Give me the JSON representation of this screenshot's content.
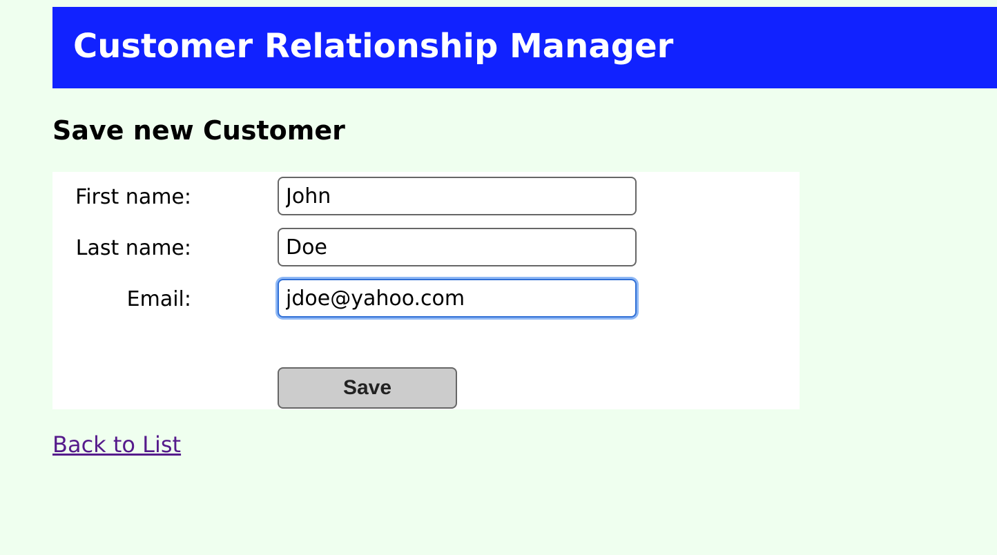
{
  "header": {
    "title": "Customer Relationship Manager",
    "background_color": "#1122ff"
  },
  "page": {
    "title": "Save new Customer",
    "background_color": "#efffef"
  },
  "form": {
    "first_name": {
      "label": "First name:",
      "value": "John"
    },
    "last_name": {
      "label": "Last name:",
      "value": "Doe"
    },
    "email": {
      "label": "Email:",
      "value": "jdoe@yahoo.com",
      "focused": true
    },
    "save_label": "Save"
  },
  "links": {
    "back": "Back to List",
    "back_color": "#551a8b"
  }
}
